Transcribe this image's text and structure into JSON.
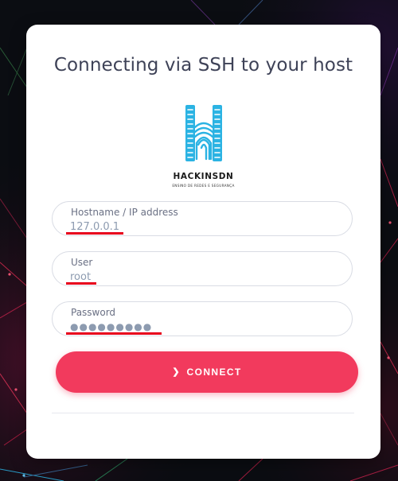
{
  "page": {
    "title": "Connecting via SSH to your host"
  },
  "brand": {
    "name": "HACKINSDN",
    "tagline": "ENSINO DE REDES E SEGURANÇA",
    "logo_icon": "fingerprint-h-logo",
    "logo_color": "#2bb3e3"
  },
  "form": {
    "hostname": {
      "label": "Hostname / IP address",
      "value": "127.0.0.1"
    },
    "user": {
      "label": "User",
      "value": "root"
    },
    "password": {
      "label": "Password",
      "value": "●●●●●●●●●"
    },
    "connect_button": {
      "label": "CONNECT",
      "icon": "chevron-right-icon"
    }
  },
  "colors": {
    "accent": "#f23a5d",
    "annotation_underline": "#e8001c"
  }
}
